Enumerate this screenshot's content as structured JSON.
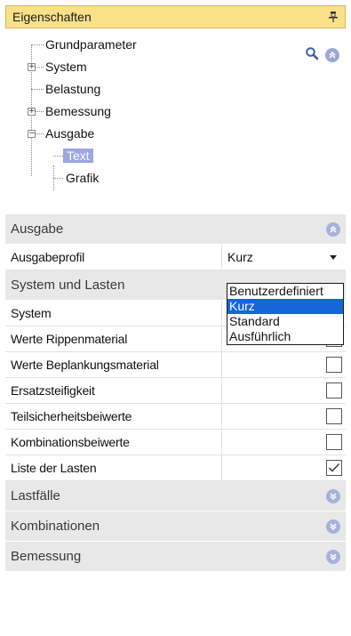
{
  "panel": {
    "title": "Eigenschaften",
    "pin_icon": "pin-icon"
  },
  "tree": {
    "items": [
      {
        "label": "Grundparameter"
      },
      {
        "label": "System"
      },
      {
        "label": "Belastung"
      },
      {
        "label": "Bemessung"
      },
      {
        "label": "Ausgabe"
      },
      {
        "label": "Text"
      },
      {
        "label": "Grafik"
      }
    ],
    "expander_plus": "+",
    "expander_minus": "−"
  },
  "grid": {
    "categories": {
      "ausgabe": "Ausgabe",
      "system_lasten": "System und Lasten",
      "lastfaelle": "Lastfälle",
      "kombinationen": "Kombinationen",
      "bemessung": "Bemessung"
    },
    "rows": {
      "ausgabeprofil": {
        "label": "Ausgabeprofil",
        "value": "Kurz"
      },
      "system": {
        "label": "System"
      },
      "werte_rippen": {
        "label": "Werte Rippenmaterial",
        "checked": false
      },
      "werte_beplankung": {
        "label": "Werte Beplankungsmaterial",
        "checked": false
      },
      "ersatzsteifigkeit": {
        "label": "Ersatzsteifigkeit",
        "checked": false
      },
      "teilsicherheit": {
        "label": "Teilsicherheitsbeiwerte",
        "checked": false
      },
      "kombinationsbeiwerte": {
        "label": "Kombinationsbeiwerte",
        "checked": false
      },
      "liste_lasten": {
        "label": "Liste der Lasten",
        "checked": true
      }
    }
  },
  "dropdown": {
    "options": [
      "Benutzerdefiniert",
      "Kurz",
      "Standard",
      "Ausführlich"
    ],
    "selected": "Kurz"
  },
  "colors": {
    "title_bar": "#fbe08a",
    "tree_selection": "#9aa7e0",
    "dropdown_selection": "#1467d8",
    "category_bg": "#e8e8e8"
  }
}
